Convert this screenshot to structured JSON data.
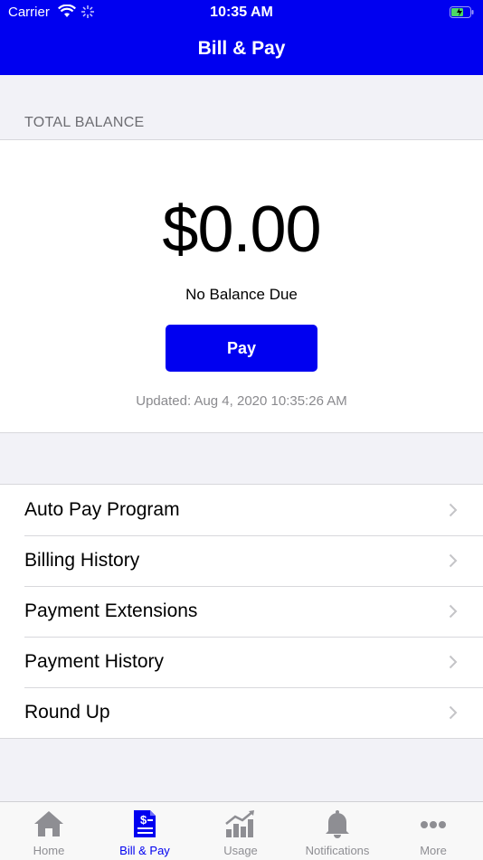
{
  "status_bar": {
    "carrier": "Carrier",
    "time": "10:35 AM"
  },
  "header": {
    "title": "Bill & Pay"
  },
  "balance": {
    "section_label": "TOTAL BALANCE",
    "amount": "$0.00",
    "status": "No Balance Due",
    "pay_label": "Pay",
    "updated": "Updated: Aug 4, 2020 10:35:26 AM"
  },
  "menu": {
    "items": [
      {
        "label": "Auto Pay Program"
      },
      {
        "label": "Billing History"
      },
      {
        "label": "Payment Extensions"
      },
      {
        "label": "Payment History"
      },
      {
        "label": "Round Up"
      }
    ]
  },
  "tabs": [
    {
      "label": "Home",
      "icon": "home-icon"
    },
    {
      "label": "Bill & Pay",
      "icon": "bill-icon",
      "active": true
    },
    {
      "label": "Usage",
      "icon": "chart-icon"
    },
    {
      "label": "Notifications",
      "icon": "bell-icon"
    },
    {
      "label": "More",
      "icon": "more-icon"
    }
  ],
  "colors": {
    "accent": "#0000f0",
    "inactive_tab": "#8e8e93",
    "background": "#f2f2f7"
  }
}
